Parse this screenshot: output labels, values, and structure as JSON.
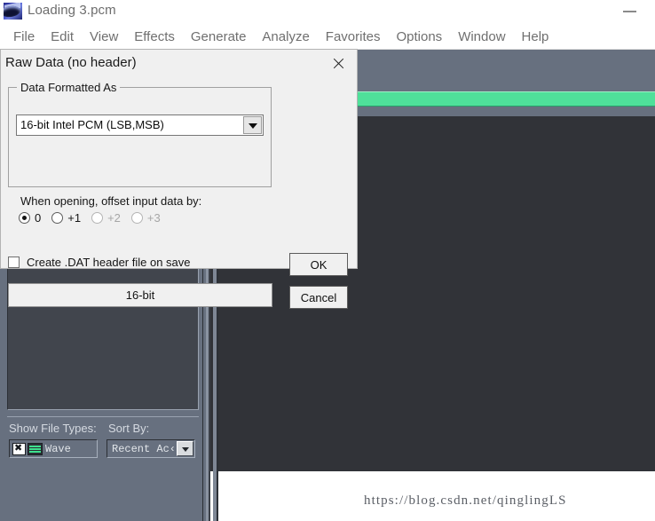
{
  "window": {
    "title": "Loading 3.pcm",
    "logo_icon": "cool-edit-logo-icon",
    "minimize_label": "—"
  },
  "menu": {
    "items": [
      {
        "label": "File"
      },
      {
        "label": "Edit"
      },
      {
        "label": "View"
      },
      {
        "label": "Effects"
      },
      {
        "label": "Generate"
      },
      {
        "label": "Analyze"
      },
      {
        "label": "Favorites"
      },
      {
        "label": "Options"
      },
      {
        "label": "Window"
      },
      {
        "label": "Help"
      }
    ]
  },
  "toolbar": {
    "groups": [
      {
        "buttons": [
          {
            "icon": "paste-clipboard-icon"
          },
          {
            "icon": "mix-paste-clipboard-icon"
          },
          {
            "icon": "noise-reduction-icon"
          },
          {
            "icon": "click-pop-eliminator-icon"
          },
          {
            "icon": "quick-filter-icon"
          }
        ]
      },
      {
        "buttons": [
          {
            "icon": "spectral-view-icon"
          },
          {
            "icon": "checkbox-view-icon"
          },
          {
            "icon": "grid-view-1-icon"
          },
          {
            "icon": "grid-view-2-icon"
          },
          {
            "icon": "grid-view-3-icon"
          }
        ]
      },
      {
        "buttons": [
          {
            "icon": "new-window-icon"
          }
        ]
      }
    ]
  },
  "level_bar": {
    "name": "level-meter",
    "fill_color": "#4fe09a",
    "track_color": "#67707f",
    "value_percent": 100
  },
  "file_panel": {
    "list_items": [],
    "show_file_types_label": "Show File Types:",
    "sort_by_label": "Sort By:",
    "file_type_value": "Wave",
    "file_type_icons": [
      "close-x-icon",
      "waveform-icon"
    ],
    "sort_by_value": "Recent Ac‹"
  },
  "dialog": {
    "title": "Raw Data (no header)",
    "close_icon": "close-icon",
    "group_title": "Data Formatted As",
    "format_combo": {
      "value": "16-bit Intel PCM (LSB,MSB)",
      "arrow_icon": "chevron-down-icon"
    },
    "offset_label": "When opening, offset input data by:",
    "offset_options": [
      {
        "label": "0",
        "checked": true,
        "disabled": false
      },
      {
        "label": "+1",
        "checked": false,
        "disabled": false
      },
      {
        "label": "+2",
        "checked": false,
        "disabled": true
      },
      {
        "label": "+3",
        "checked": false,
        "disabled": true
      }
    ],
    "dat_checkbox": {
      "label": "Create .DAT header file on save",
      "checked": false
    },
    "bitdepth_button_label": "16-bit",
    "ok_label": "OK",
    "cancel_label": "Cancel"
  },
  "watermark": {
    "text": "https://blog.csdn.net/qinglingLS"
  },
  "colors": {
    "dialog_face": "#f0f0f0",
    "panel_face": "#67707f",
    "editor_bg": "#313338",
    "level_green": "#4fe09a",
    "title_text": "#6d6d6d"
  }
}
